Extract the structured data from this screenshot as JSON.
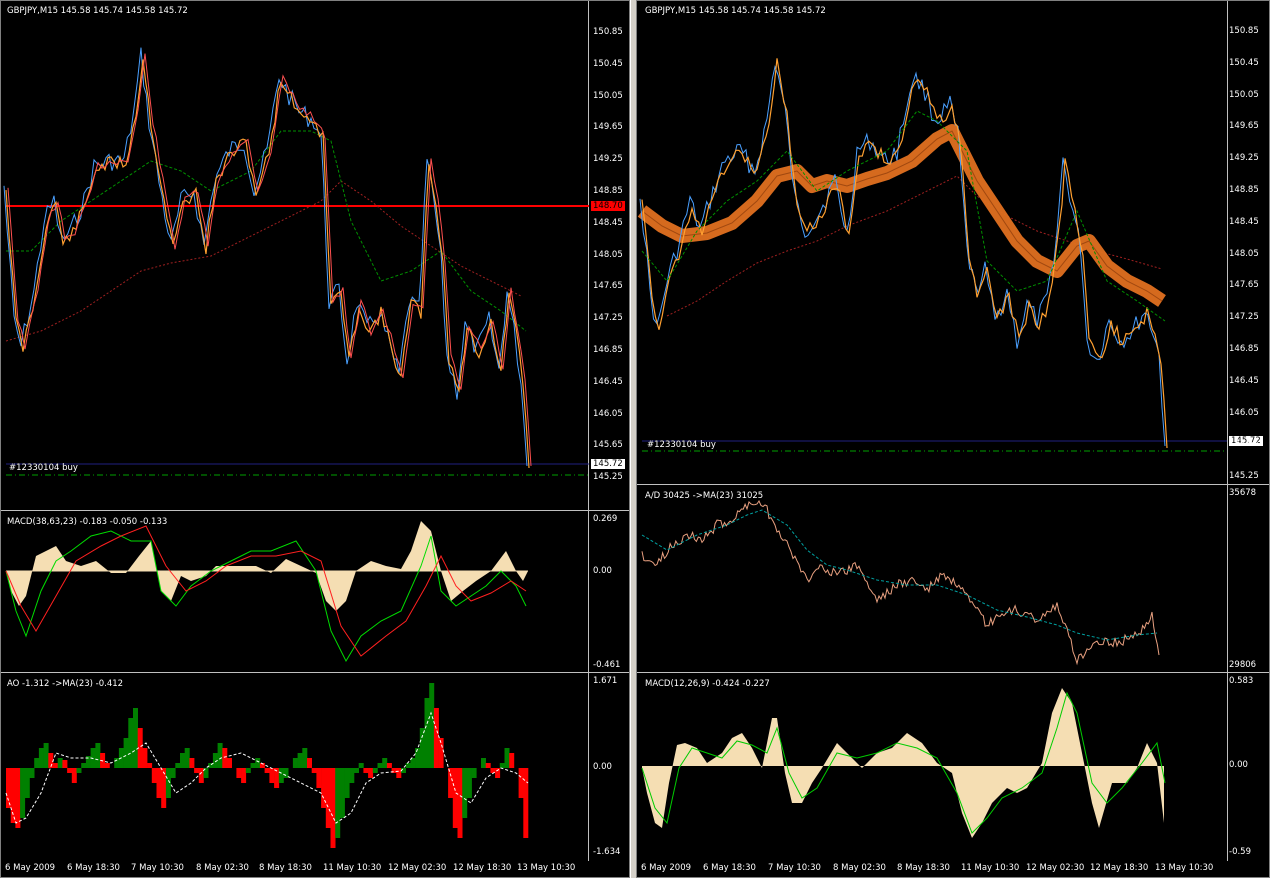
{
  "left": {
    "main": {
      "title": "GBPJPY,M15  145.58 145.74 145.58 145.72",
      "ticks": [
        "150.85",
        "150.45",
        "150.05",
        "149.65",
        "149.25",
        "148.85",
        "148.45",
        "148.05",
        "147.65",
        "147.25",
        "146.85",
        "146.45",
        "146.05",
        "145.65",
        "145.25"
      ],
      "order_label": "#12330104 buy",
      "red_line_price": "148.70",
      "current_price": "145.72"
    },
    "macd": {
      "label": "MACD(38,63,23) -0.183 -0.050 -0.133",
      "ticks": [
        "0.269",
        "0.00",
        "-0.461"
      ]
    },
    "ao": {
      "label": "AO -1.312  ->MA(23) -0.412",
      "ticks": [
        "1.671",
        "0.00",
        "-1.634"
      ]
    },
    "xticks": [
      "6 May 2009",
      "6 May 18:30",
      "7 May 10:30",
      "8 May 02:30",
      "8 May 18:30",
      "11 May 10:30",
      "12 May 02:30",
      "12 May 18:30",
      "13 May 10:30"
    ]
  },
  "right": {
    "main": {
      "title": "GBPJPY,M15  145.58 145.74 145.58 145.72",
      "ticks": [
        "150.85",
        "150.45",
        "150.05",
        "149.65",
        "149.25",
        "148.85",
        "148.45",
        "148.05",
        "147.65",
        "147.25",
        "146.85",
        "146.45",
        "146.05",
        "145.65",
        "145.25"
      ],
      "order_label": "#12330104 buy",
      "current_price": "145.72"
    },
    "ad": {
      "label": "A/D 30425  ->MA(23) 31025",
      "ticks": [
        "35678",
        "29806"
      ]
    },
    "macd": {
      "label": "MACD(12,26,9) -0.424 -0.227",
      "ticks": [
        "0.583",
        "0.00",
        "-0.59"
      ]
    },
    "xticks": [
      "6 May 2009",
      "6 May 18:30",
      "7 May 10:30",
      "8 May 02:30",
      "8 May 18:30",
      "11 May 10:30",
      "12 May 02:30",
      "12 May 18:30",
      "13 May 10:30"
    ]
  },
  "chart_data": {
    "type": "line",
    "title": "GBPJPY,M15",
    "x": [
      "6 May 2009",
      "6 May 18:30",
      "7 May 10:30",
      "8 May 02:30",
      "8 May 18:30",
      "11 May 10:30",
      "12 May 02:30",
      "12 May 18:30",
      "13 May 10:30"
    ],
    "series": [
      {
        "name": "GBPJPY,M15",
        "values": [
          147.3,
          149.3,
          150.5,
          148.6,
          150.3,
          147.3,
          149.1,
          147.0,
          145.7
        ]
      }
    ],
    "ylim": [
      145.25,
      150.85
    ]
  },
  "colors": {
    "background": "#000000",
    "price_line": "#ff0000",
    "ribbon": "#e07020",
    "histogram": "#f5deb3",
    "macd_main": "#00dd00",
    "macd_signal": "#ff2020",
    "ao_up": "#008000",
    "ao_down": "#ff0000",
    "ad_line": "#e8a080"
  }
}
